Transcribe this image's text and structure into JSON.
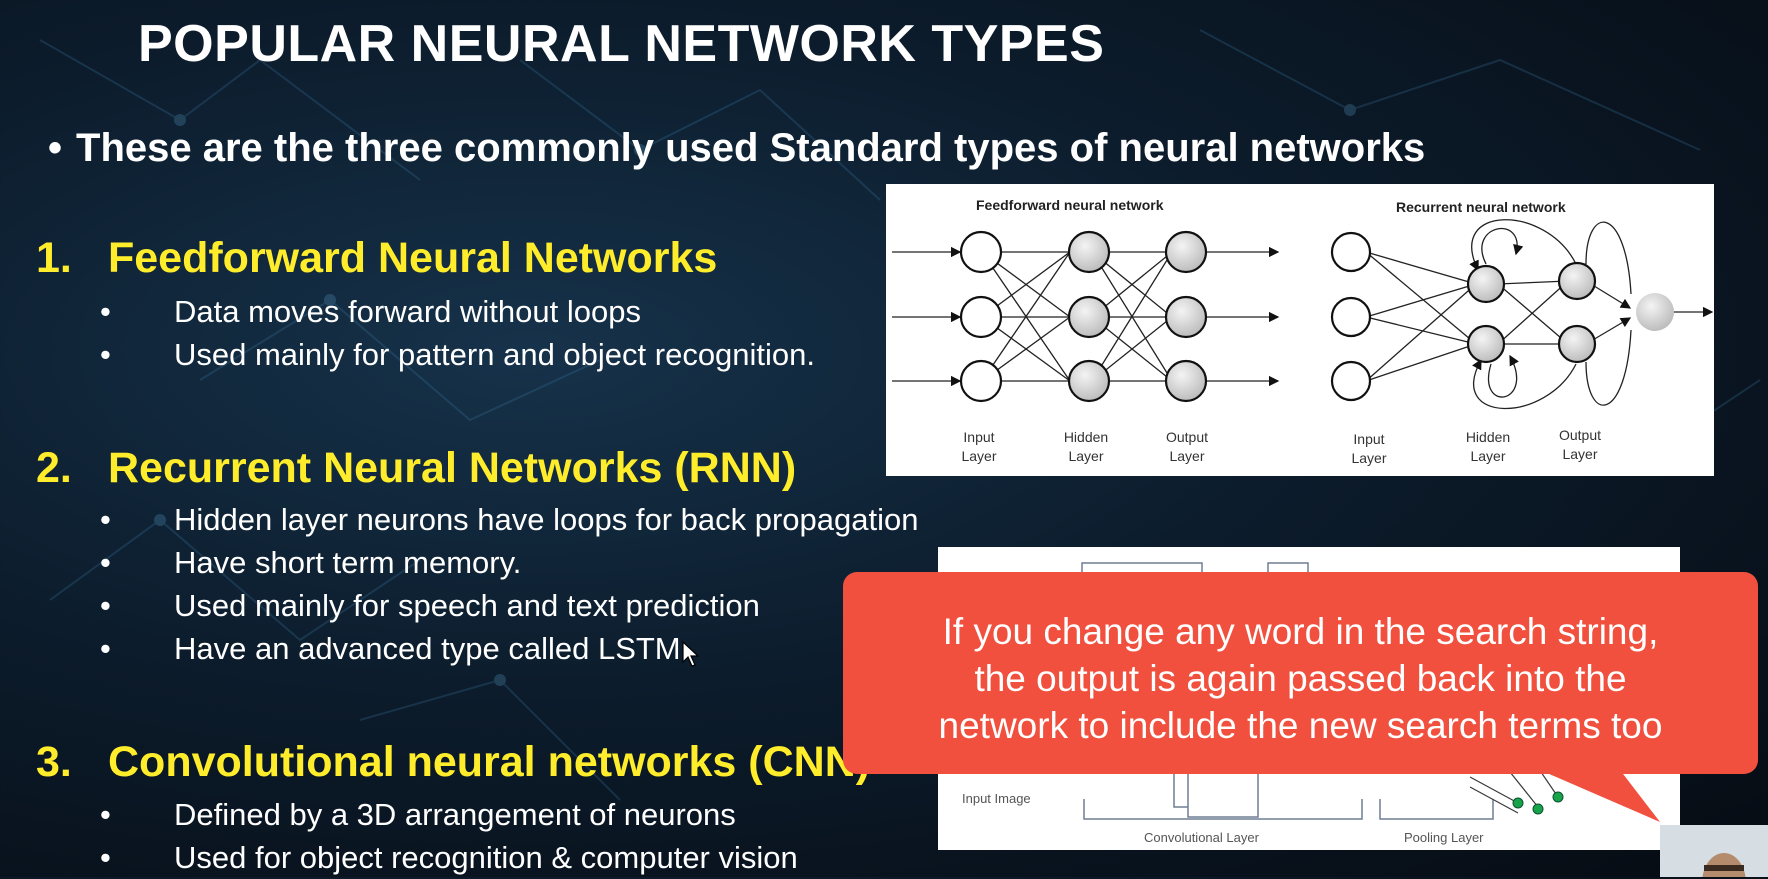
{
  "slide": {
    "title": "POPULAR NEURAL NETWORK TYPES",
    "intro": "These are the three commonly used Standard types of neural networks",
    "bullet_char": "•",
    "sections": [
      {
        "number": "1.",
        "heading": "Feedforward Neural Networks",
        "bullets": [
          "Data moves forward without loops",
          "Used mainly for pattern and object recognition."
        ]
      },
      {
        "number": "2.",
        "heading": "Recurrent Neural Networks (RNN)",
        "bullets": [
          "Hidden layer neurons have loops for back propagation",
          "Have short term memory.",
          "Used mainly for speech and text prediction",
          "Have an advanced type called LSTM"
        ]
      },
      {
        "number": "3.",
        "heading": "Convolutional neural networks (CNN)",
        "bullets": [
          "Defined by a 3D arrangement of neurons",
          "Used for object recognition & computer vision"
        ]
      }
    ]
  },
  "diagram": {
    "feedforward_title": "Feedforward neural network",
    "recurrent_title": "Recurrent neural network",
    "ff_labels": [
      [
        "Input",
        "Layer"
      ],
      [
        "Hidden",
        "Layer"
      ],
      [
        "Output",
        "Layer"
      ]
    ],
    "rnn_labels": [
      [
        "Input",
        "Layer"
      ],
      [
        "Hidden",
        "Layer"
      ],
      [
        "Output",
        "Layer"
      ]
    ]
  },
  "cnn_diagram": {
    "input_label": "Input Image",
    "conv_label": "Convolutional Layer",
    "pool_label": "Pooling Layer"
  },
  "callout": {
    "lines": [
      "If you change any word in the search string,",
      "the output is again passed back into the",
      "network to include the new search terms too"
    ],
    "color": "#f0503d"
  },
  "colors": {
    "heading": "#ffed2b",
    "text": "#ffffff",
    "background": "#0c1c2c"
  }
}
